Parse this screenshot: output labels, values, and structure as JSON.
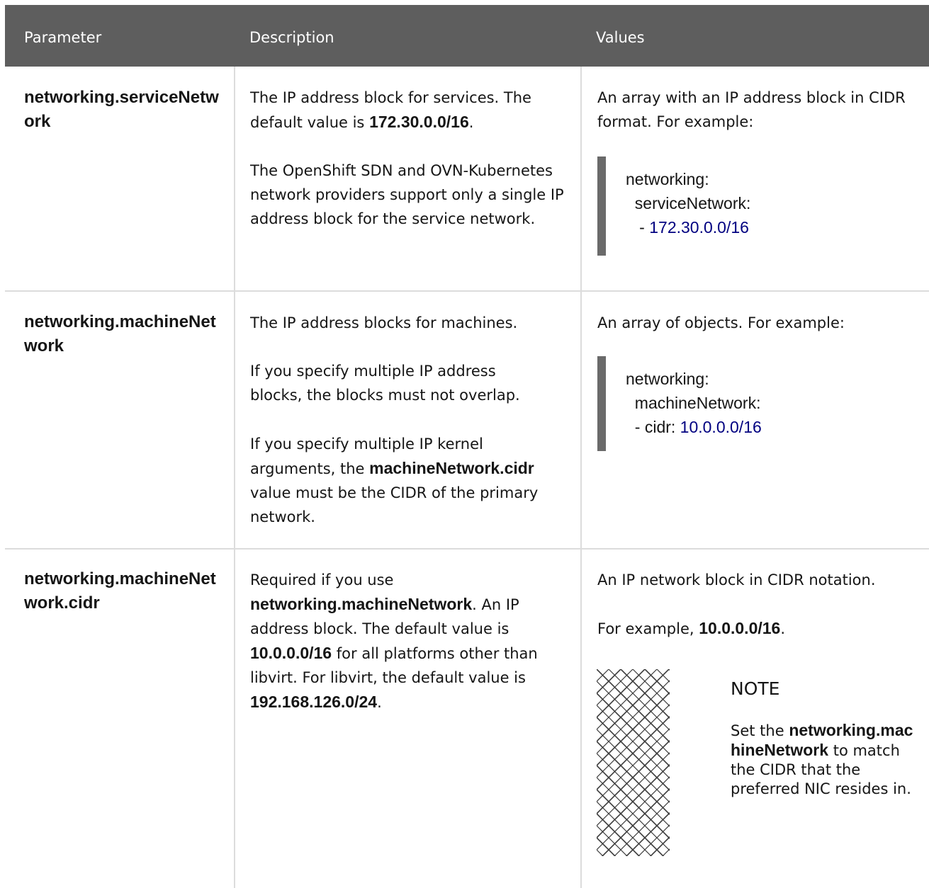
{
  "header": {
    "parameter": "Parameter",
    "description": "Description",
    "values": "Values"
  },
  "rows": [
    {
      "param": "networking.serviceNetwork",
      "desc1_pre": "The IP address block for services. The default value is ",
      "desc1_bold": "172.30.0.0/16",
      "desc1_post": ".",
      "desc2": "The OpenShift SDN and OVN-Kubernetes network providers support only a single IP address block for the service network.",
      "values_intro": "An array with an IP address block in CIDR format. For example:",
      "code_line1": "networking:",
      "code_line2": "  serviceNetwork:",
      "code_line3_prefix": "   - ",
      "code_line3_value": "172.30.0.0/16"
    },
    {
      "param": "networking.machineNetwork",
      "desc1": "The IP address blocks for machines.",
      "desc2": "If you specify multiple IP address blocks, the blocks must not overlap.",
      "desc3_pre": "If you specify multiple IP kernel arguments, the ",
      "desc3_bold": "machineNetwork.cidr",
      "desc3_post": " value must be the CIDR of the primary network.",
      "values_intro": "An array of objects. For example:",
      "code_line1": "networking:",
      "code_line2": "  machineNetwork:",
      "code_line3_prefix": "  - cidr: ",
      "code_line3_value": "10.0.0.0/16"
    },
    {
      "param": "networking.machineNetwork.cidr",
      "desc_pre": "Required if you use ",
      "desc_bold1": "networking.machineNetwork",
      "desc_mid1": ". An IP address block. The default value is ",
      "desc_bold2": "10.0.0.0/16",
      "desc_mid2": " for all platforms other than libvirt. For libvirt, the default value is ",
      "desc_bold3": "192.168.126.0/24",
      "desc_post": ".",
      "values_intro": "An IP network block in CIDR notation.",
      "example_pre": "For example, ",
      "example_bold": "10.0.0.0/16",
      "example_post": ".",
      "note_title": "NOTE",
      "note_pre": "Set the ",
      "note_bold": "networking.machineNetwork",
      "note_post": " to match the CIDR that the preferred NIC resides in."
    }
  ],
  "icons": {
    "note": "note-pattern-icon"
  },
  "colors": {
    "header_bg": "#5e5e5e",
    "code_bar": "#6a6a6a",
    "code_number": "#000080"
  }
}
